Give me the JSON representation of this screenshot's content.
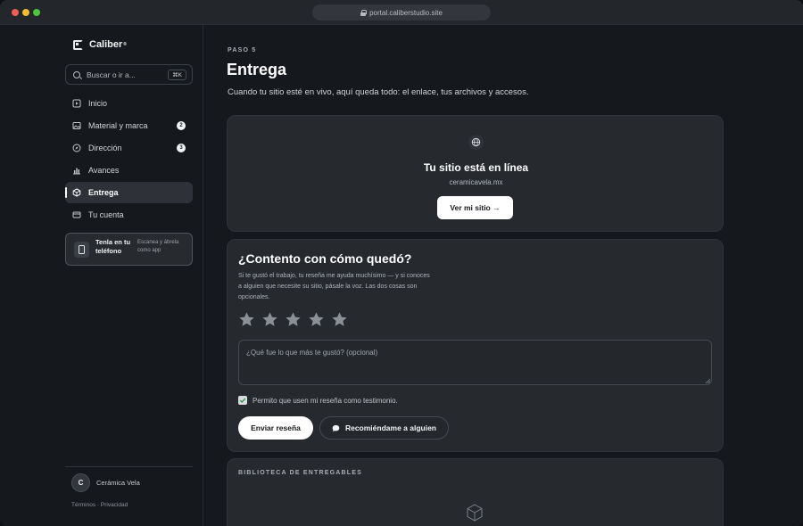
{
  "browser": {
    "url": "portal.caliberstudio.site"
  },
  "sidebar": {
    "brand": "Caliber",
    "brand_mark": "®",
    "search": {
      "placeholder": "Buscar o ir a...",
      "shortcut": "⌘K"
    },
    "items": [
      {
        "label": "Inicio",
        "icon": "play-square-icon",
        "badge": ""
      },
      {
        "label": "Material y marca",
        "icon": "image-icon",
        "badge": "2"
      },
      {
        "label": "Dirección",
        "icon": "compass-icon",
        "badge": "3"
      },
      {
        "label": "Avances",
        "icon": "bar-chart-icon",
        "badge": ""
      },
      {
        "label": "Entrega",
        "icon": "package-icon",
        "badge": "",
        "active": true
      },
      {
        "label": "Tu cuenta",
        "icon": "card-icon",
        "badge": ""
      }
    ],
    "phone_card": {
      "title": "Tenla en tu teléfono",
      "subtitle": "Escanea y ábrela como app"
    },
    "user": {
      "initial": "C",
      "name": "Cerámica Vela"
    },
    "links": {
      "terms": "Términos",
      "separator": "·",
      "privacy": "Privacidad"
    }
  },
  "main": {
    "step": "PASO 5",
    "title": "Entrega",
    "subtitle": "Cuando tu sitio esté en vivo, aquí queda todo: el enlace, tus archivos y accesos.",
    "live": {
      "title": "Tu sitio está en línea",
      "domain": "ceramicavela.mx",
      "button": "Ver mi sitio →"
    },
    "review": {
      "title": "¿Contento con cómo quedó?",
      "description": "Si te gustó el trabajo, tu reseña me ayuda muchísimo — y si conoces a alguien que necesite su sitio, pásale la voz. Las dos cosas son opcionales.",
      "rating": 0,
      "max_rating": 5,
      "textarea_placeholder": "¿Qué fue lo que más te gustó? (opcional)",
      "consent_label": "Permito que usen mi reseña como testimonio.",
      "consent_checked": true,
      "send_button": "Enviar reseña",
      "recommend_button": "Recomiéndame a alguien"
    },
    "library": {
      "title": "BIBLIOTECA DE ENTREGABLES"
    }
  },
  "colors": {
    "background": "#15181c",
    "card": "#262a2f",
    "accent": "#ffffff",
    "star": "#8b9096"
  }
}
